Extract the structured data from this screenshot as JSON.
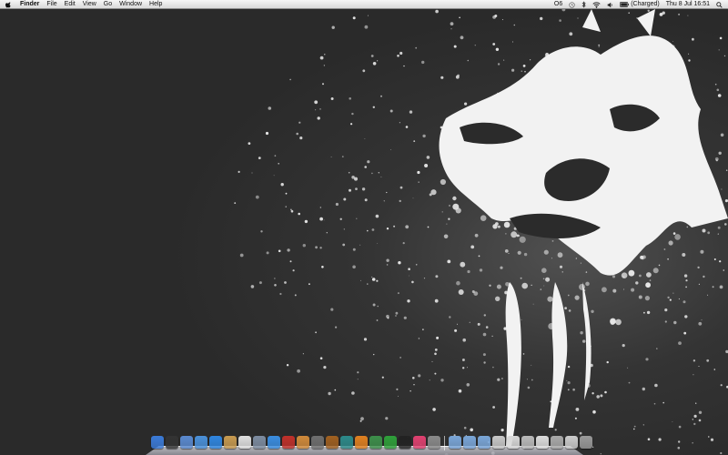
{
  "menubar": {
    "app_name": "Finder",
    "menus": [
      "File",
      "Edit",
      "View",
      "Go",
      "Window",
      "Help"
    ],
    "status": {
      "item1": "O6",
      "battery": "(Charged)",
      "clock": "Thu 8 Jul  16:51"
    }
  },
  "dock": {
    "apps": [
      {
        "icon": "finder-icon",
        "color": "#3b7bd8"
      },
      {
        "icon": "dashboard-icon",
        "color": "#333333"
      },
      {
        "icon": "mail-icon",
        "color": "#5a8ad0"
      },
      {
        "icon": "safari-icon",
        "color": "#4a90d9"
      },
      {
        "icon": "ichat-icon",
        "color": "#2f86e0"
      },
      {
        "icon": "address-book-icon",
        "color": "#c79a50"
      },
      {
        "icon": "ical-icon",
        "color": "#e0e0e0"
      },
      {
        "icon": "preview-icon",
        "color": "#7d8ca0"
      },
      {
        "icon": "itunes-icon",
        "color": "#3a8de0"
      },
      {
        "icon": "photo-booth-icon",
        "color": "#c0302a"
      },
      {
        "icon": "iphoto-icon",
        "color": "#d08a3a"
      },
      {
        "icon": "garageband-icon",
        "color": "#6f6f6f"
      },
      {
        "icon": "guitar-icon",
        "color": "#a06020"
      },
      {
        "icon": "time-machine-icon",
        "color": "#2c8a8a"
      },
      {
        "icon": "vlc-icon",
        "color": "#e08020"
      },
      {
        "icon": "app-store-icon",
        "color": "#3d8f4a"
      },
      {
        "icon": "utorrent-icon",
        "color": "#2ea03a"
      },
      {
        "icon": "steam-icon",
        "color": "#222222"
      },
      {
        "icon": "app-pink-icon",
        "color": "#e04070"
      },
      {
        "icon": "system-preferences-icon",
        "color": "#8a8a8a"
      }
    ],
    "stacks": [
      {
        "icon": "applications-folder-icon",
        "color": "#7aa6d8"
      },
      {
        "icon": "documents-folder-icon",
        "color": "#7aa6d8"
      },
      {
        "icon": "downloads-folder-icon",
        "color": "#7aa6d8"
      },
      {
        "icon": "stack-1-icon",
        "color": "#c8c8c8"
      },
      {
        "icon": "stack-2-icon",
        "color": "#d8d8d8"
      },
      {
        "icon": "stack-3-icon",
        "color": "#bbbbbb"
      },
      {
        "icon": "stack-4-icon",
        "color": "#dddddd"
      },
      {
        "icon": "stack-5-icon",
        "color": "#aaaaaa"
      },
      {
        "icon": "stack-6-icon",
        "color": "#cccccc"
      },
      {
        "icon": "trash-icon",
        "color": "#9a9a9a"
      }
    ]
  }
}
